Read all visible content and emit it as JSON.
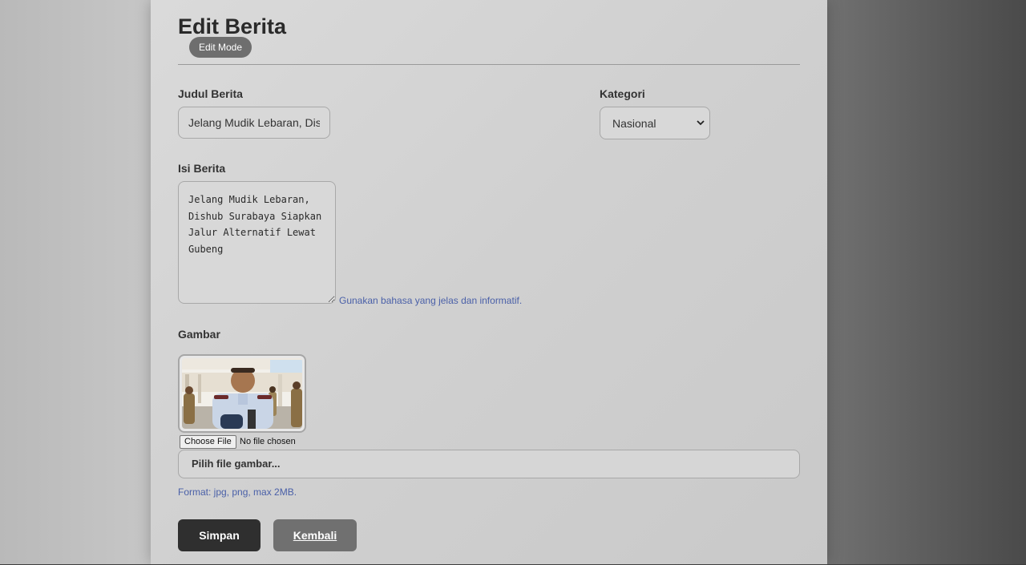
{
  "page": {
    "title": "Edit Berita",
    "mode_badge": "Edit Mode"
  },
  "form": {
    "judul": {
      "label": "Judul Berita",
      "value": "Jelang Mudik Lebaran, Dishub Surabaya Siapkan Jalur Alternatif Lewat Gubeng"
    },
    "kategori": {
      "label": "Kategori",
      "selected": "Nasional"
    },
    "isi": {
      "label": "Isi Berita",
      "value": "Jelang Mudik Lebaran, Dishub Surabaya Siapkan Jalur Alternatif Lewat Gubeng",
      "hint": "Gunakan bahasa yang jelas dan informatif."
    },
    "gambar": {
      "label": "Gambar",
      "choose_file_label": "Choose File",
      "no_file_text": "No file chosen",
      "picker_label": "Pilih file gambar...",
      "format_hint": "Format: jpg, png, max 2MB."
    }
  },
  "actions": {
    "save_label": "Simpan",
    "back_label": "Kembali"
  },
  "colors": {
    "primary_button": "#2f2f2f",
    "secondary_button": "#707070",
    "hint_text": "#4a60a8"
  }
}
